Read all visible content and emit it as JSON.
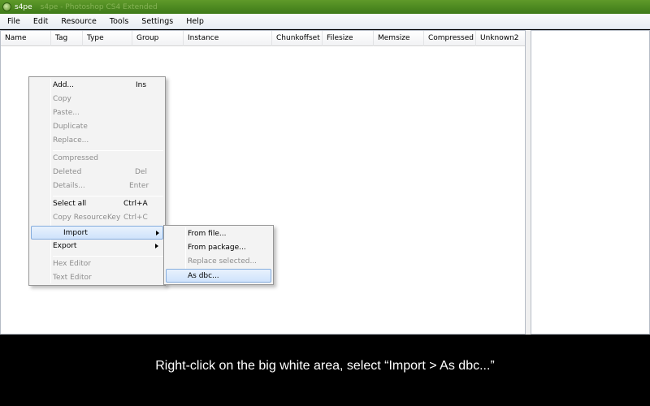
{
  "window": {
    "title": "s4pe",
    "faded_title": "s4pe - Photoshop CS4 Extended"
  },
  "menubar": [
    "File",
    "Edit",
    "Resource",
    "Tools",
    "Settings",
    "Help"
  ],
  "columns": [
    "Name",
    "Tag",
    "Type",
    "Group",
    "Instance",
    "Chunkoffset",
    "Filesize",
    "Memsize",
    "Compressed",
    "Unknown2"
  ],
  "context_menu": {
    "add": {
      "label": "Add...",
      "shortcut": "Ins"
    },
    "copy": {
      "label": "Copy"
    },
    "paste": {
      "label": "Paste..."
    },
    "duplicate": {
      "label": "Duplicate"
    },
    "replace": {
      "label": "Replace..."
    },
    "compressed": {
      "label": "Compressed"
    },
    "deleted": {
      "label": "Deleted",
      "shortcut": "Del"
    },
    "details": {
      "label": "Details...",
      "shortcut": "Enter"
    },
    "select_all": {
      "label": "Select all",
      "shortcut": "Ctrl+A"
    },
    "copy_key": {
      "label": "Copy ResourceKey",
      "shortcut": "Ctrl+C"
    },
    "import": {
      "label": "Import"
    },
    "export": {
      "label": "Export"
    },
    "hex_editor": {
      "label": "Hex Editor"
    },
    "text_editor": {
      "label": "Text Editor"
    }
  },
  "import_submenu": {
    "from_file": "From file...",
    "from_package": "From package...",
    "replace_selected": "Replace selected...",
    "as_dbc": "As dbc..."
  },
  "caption": "Right-click on the big white area, select “Import > As dbc...”"
}
